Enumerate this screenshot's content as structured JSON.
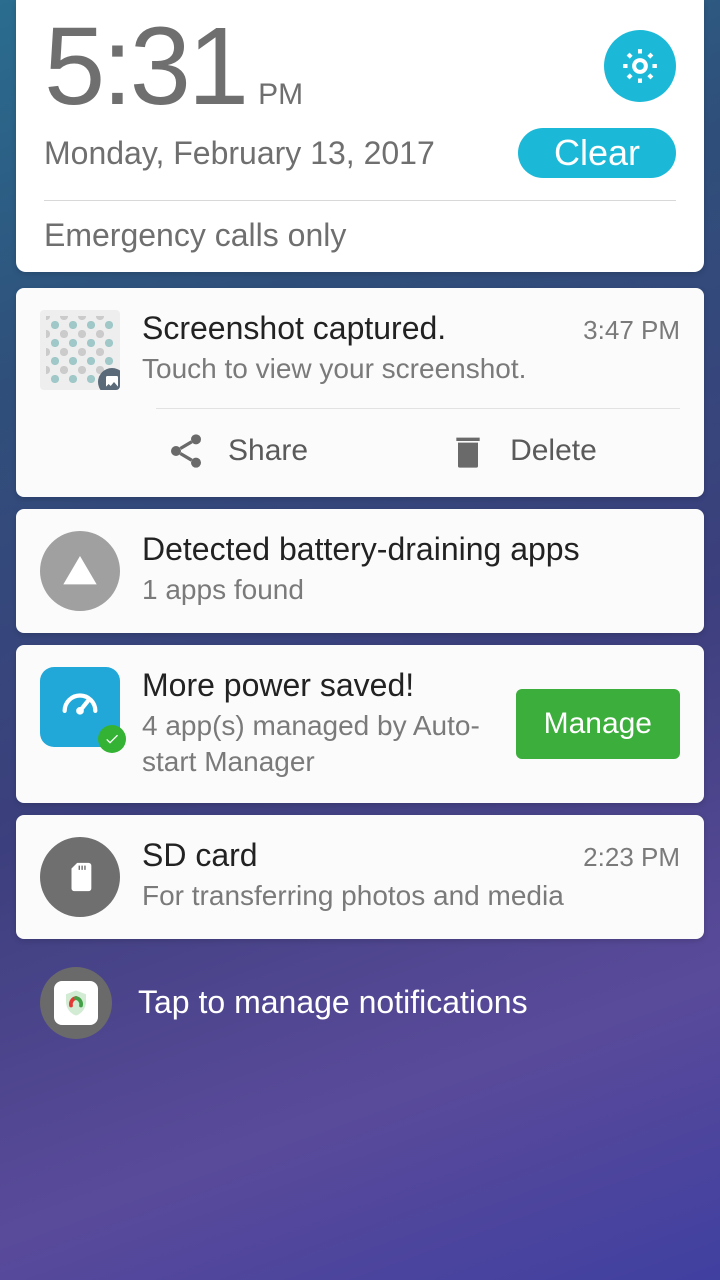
{
  "header": {
    "time": "5:31",
    "ampm": "PM",
    "date": "Monday, February 13, 2017",
    "clear_label": "Clear",
    "status": "Emergency calls only"
  },
  "notifications": [
    {
      "title": "Screenshot captured.",
      "subtitle": "Touch to view your screenshot.",
      "time": "3:47 PM",
      "actions": {
        "share": "Share",
        "delete": "Delete"
      }
    },
    {
      "title": "Detected battery-draining apps",
      "subtitle": "1 apps found"
    },
    {
      "title": "More power saved!",
      "subtitle": "4 app(s) managed by Auto-start Manager",
      "button": "Manage"
    },
    {
      "title": "SD card",
      "subtitle": "For transferring photos and media",
      "time": "2:23 PM"
    }
  ],
  "footer": {
    "text": "Tap to manage notifications"
  }
}
